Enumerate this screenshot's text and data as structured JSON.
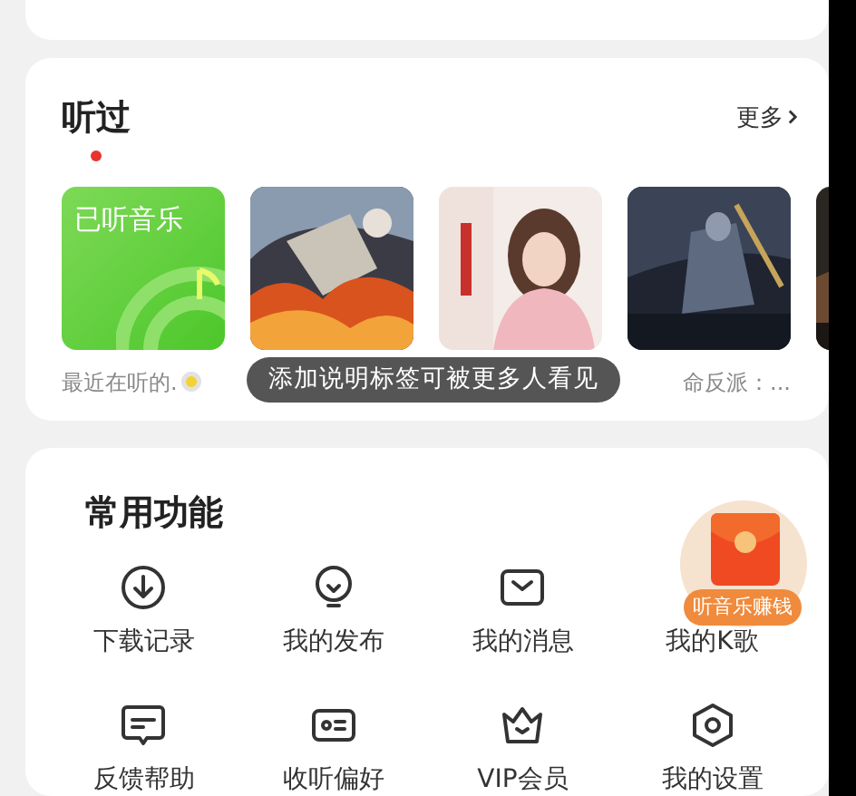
{
  "history": {
    "title": "听过",
    "more": "更多",
    "new_dot": true,
    "items": [
      {
        "kind": "music",
        "title": "已听音乐",
        "caption": "最近在听的."
      },
      {
        "kind": "picture"
      },
      {
        "kind": "picture"
      },
      {
        "kind": "picture",
        "caption": "命反派：..."
      },
      {
        "kind": "picture"
      }
    ],
    "tooltip": "添加说明标签可被更多人看见"
  },
  "functions": {
    "title": "常用功能",
    "items": [
      {
        "label": "下载记录"
      },
      {
        "label": "我的发布"
      },
      {
        "label": "我的消息"
      },
      {
        "label": "我的K歌"
      },
      {
        "label": "反馈帮助"
      },
      {
        "label": "收听偏好"
      },
      {
        "label": "VIP会员"
      },
      {
        "label": "我的设置"
      }
    ]
  },
  "promo": {
    "label": "听音乐赚钱"
  }
}
